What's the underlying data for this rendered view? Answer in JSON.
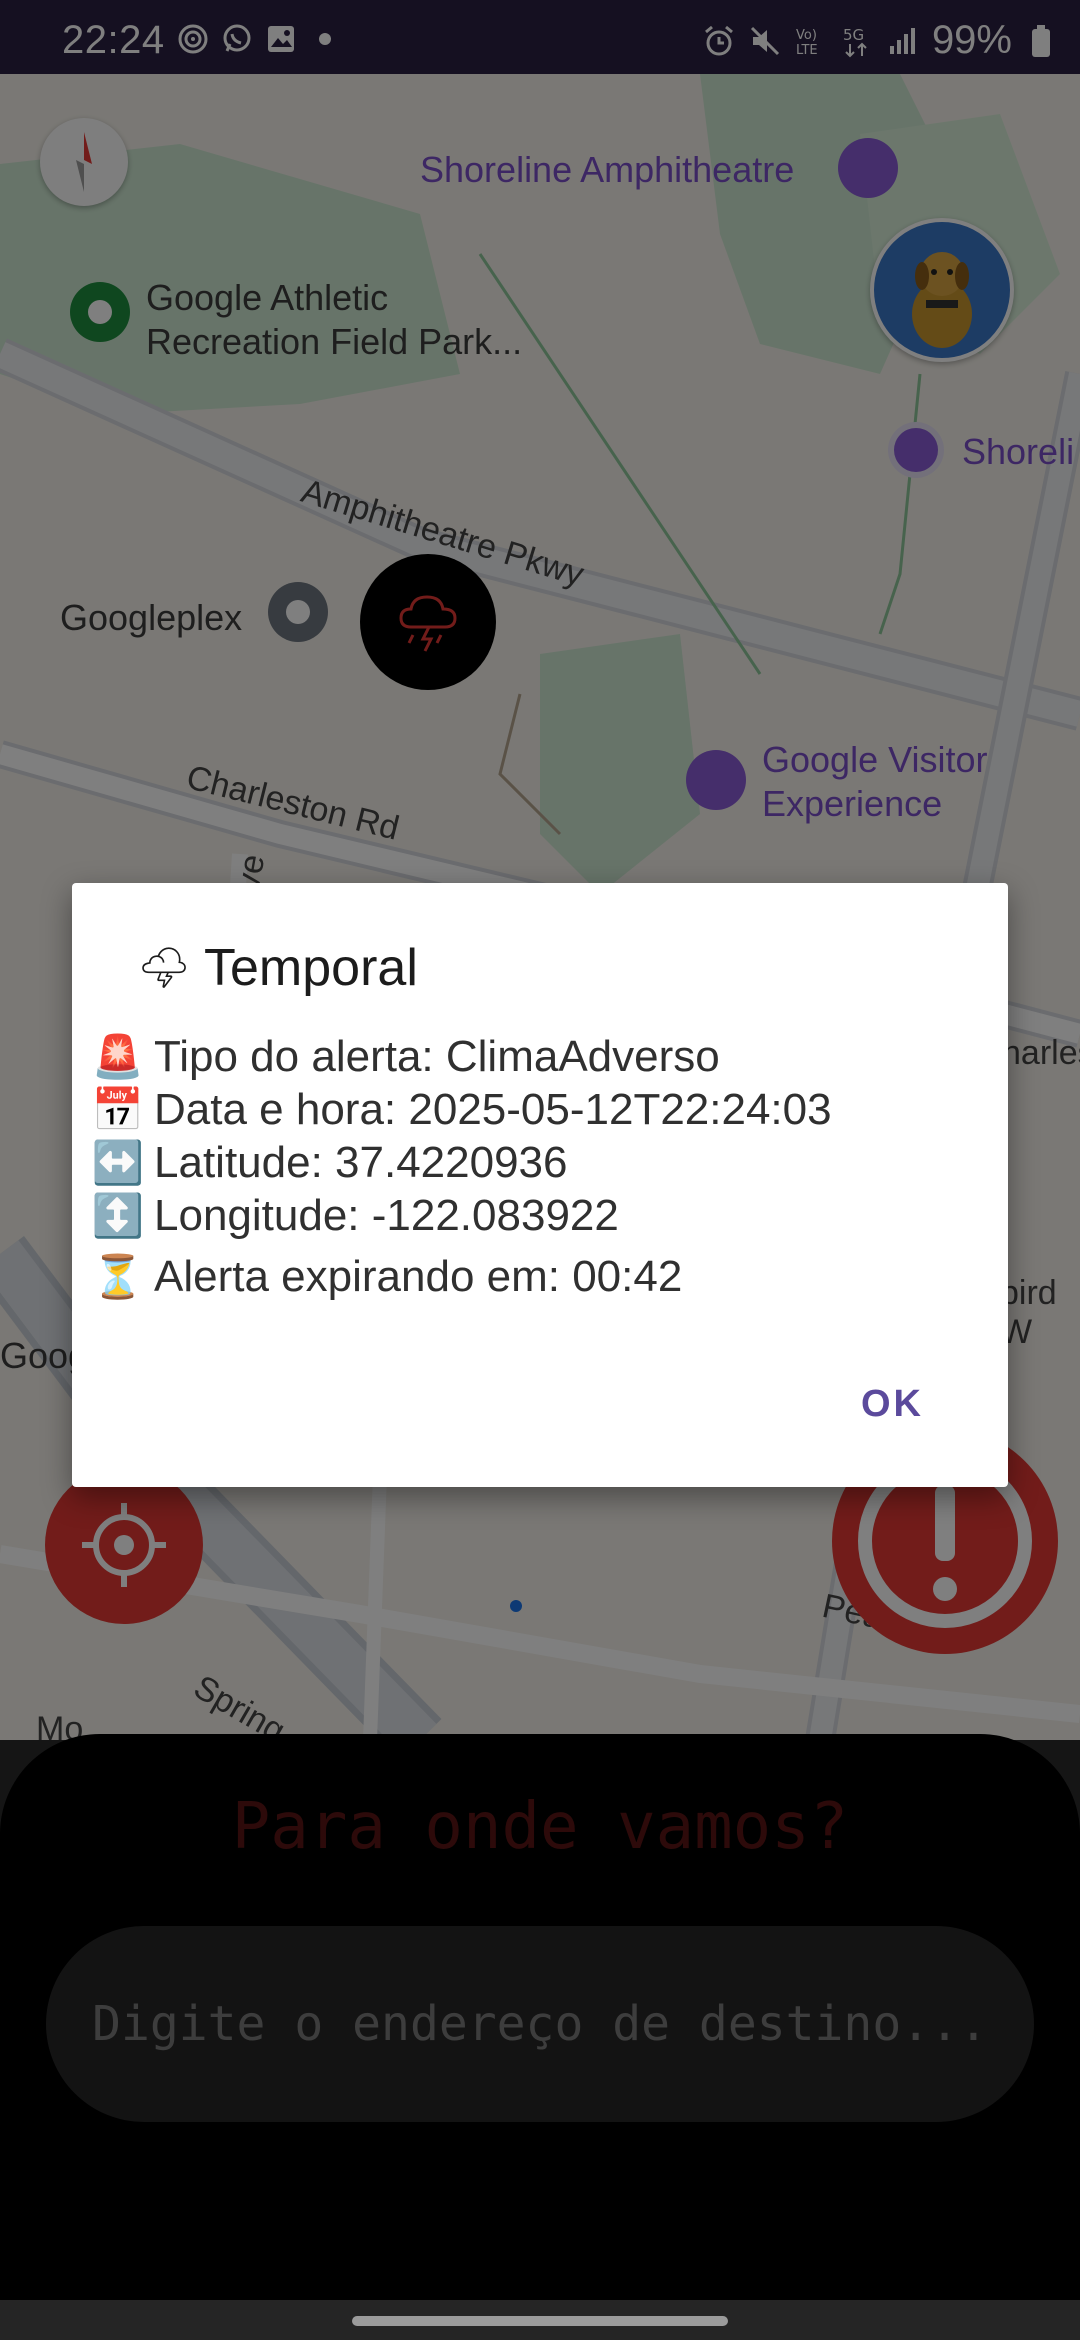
{
  "status_bar": {
    "time": "22:24",
    "battery": "99%",
    "left_icons": [
      "fingerprint-icon",
      "whatsapp-icon",
      "gallery-icon",
      "dot-icon"
    ],
    "right_icons": [
      "alarm-icon",
      "mute-icon",
      "volte-icon",
      "5g-icon",
      "signal-icon",
      "battery-icon"
    ]
  },
  "map": {
    "places": {
      "shoreline_amphitheatre": "Shoreline Amphitheatre",
      "google_athletic": "Google Athletic\nRecreation Field Park...",
      "googleplex": "Googleplex",
      "google_visitor": "Google Visitor\nExperience",
      "shoreline_parking": "Shoreli",
      "googl_partial": "Goog"
    },
    "roads": {
      "amphitheatre_pkwy": "Amphitheatre Pkwy",
      "charleston_rd": "Charleston Rd",
      "ave": "Ave",
      "charles": "harles",
      "bird": "bird W",
      "spring": "Spring",
      "pear": "Pear",
      "mo": "Mo"
    }
  },
  "dialog": {
    "title": "Temporal",
    "title_emoji": "🌩",
    "rows": [
      {
        "emoji": "🚨",
        "text": "Tipo do alerta: ClimaAdverso"
      },
      {
        "emoji": "📅",
        "text": "Data e hora: 2025-05-12T22:24:03"
      },
      {
        "emoji": "↔️",
        "text": "Latitude: 37.4220936"
      },
      {
        "emoji": "↕️",
        "text": "Longitude: -122.083922"
      },
      {
        "emoji": "⏳",
        "text": "Alerta expirando em: 00:42"
      }
    ],
    "ok_label": "OK"
  },
  "bottom_sheet": {
    "title": "Para onde vamos?",
    "input_placeholder": "Digite o endereço de destino..."
  },
  "colors": {
    "status_bar": "#2b2143",
    "accent_red": "#e53935",
    "dialog_button": "#5b4a9c",
    "sheet_title": "#5a1515"
  }
}
